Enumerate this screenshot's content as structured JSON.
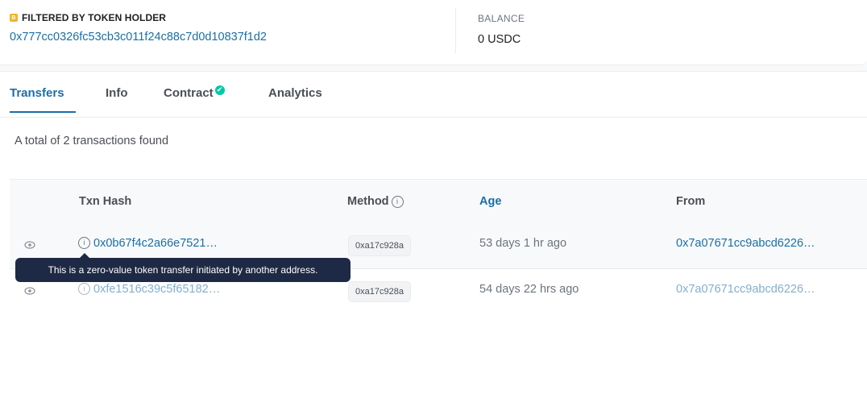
{
  "holder": {
    "label": "FILTERED BY TOKEN HOLDER",
    "badge": "B",
    "address": "0x777cc0326fc53cb3c011f24c88c7d0d10837f1d2"
  },
  "balance": {
    "label": "BALANCE",
    "value": "0 USDC"
  },
  "tabs": [
    {
      "label": "Transfers",
      "active": true
    },
    {
      "label": "Info",
      "active": false
    },
    {
      "label": "Contract",
      "active": false,
      "verified_icon": "check-circle-icon"
    },
    {
      "label": "Analytics",
      "active": false
    }
  ],
  "summary": "A total of 2 transactions found",
  "table": {
    "headers": {
      "txn_hash": "Txn Hash",
      "method": "Method",
      "age": "Age",
      "from": "From"
    },
    "rows": [
      {
        "txn_hash": "0x0b67f4c2a66e7521…",
        "method": "0xa17c928a",
        "age": "53 days 1 hr ago",
        "from": "0x7a07671cc9abcd6226…"
      },
      {
        "txn_hash": "0xfe1516c39c5f65182…",
        "method": "0xa17c928a",
        "age": "54 days 22 hrs ago",
        "from": "0x7a07671cc9abcd6226…"
      }
    ]
  },
  "tooltip": "This is a zero-value token transfer initiated by another address.",
  "icons": {
    "info": "ⓘ",
    "eye": "👁",
    "check": "✔"
  },
  "colors": {
    "link": "#1a6fa6",
    "verified": "#00c9a7",
    "tooltip_bg": "#1e2a45",
    "badge": "#f0b429"
  }
}
